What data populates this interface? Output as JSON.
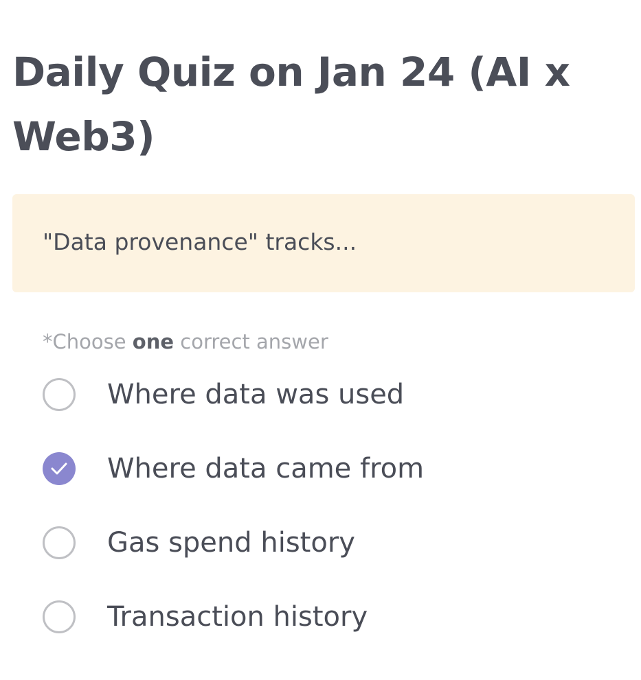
{
  "quiz": {
    "title": "Daily Quiz on Jan 24 (AI x Web3)",
    "question": "\"Data provenance\" tracks...",
    "instruction": {
      "prefix": "*Choose ",
      "emphasis": "one",
      "suffix": " correct answer"
    },
    "options": [
      {
        "label": "Where data was used",
        "selected": false
      },
      {
        "label": "Where data came from",
        "selected": true
      },
      {
        "label": "Gas spend history",
        "selected": false
      },
      {
        "label": "Transaction history",
        "selected": false
      }
    ]
  },
  "colors": {
    "title": "#4b4e58",
    "question_bg": "#fdf3e1",
    "radio_border": "#bfc0c4",
    "radio_selected": "#8a87cf",
    "instruction": "#a4a6ab"
  },
  "icons": {
    "radio_unchecked": "radio-unchecked-icon",
    "radio_checked": "radio-checked-icon"
  }
}
